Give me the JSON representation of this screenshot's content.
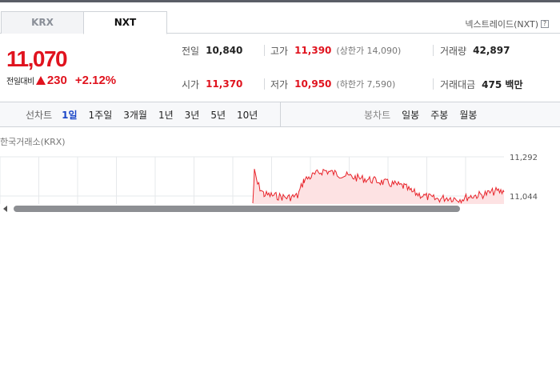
{
  "tabs": [
    {
      "label": "KRX",
      "active": false
    },
    {
      "label": "NXT",
      "active": true
    }
  ],
  "nxt_link": {
    "label": "넥스트레이드(NXT)",
    "icon": "help-icon",
    "icon_glyph": "?"
  },
  "quote": {
    "price": "11,070",
    "change_label": "전일대비",
    "change_value": "230",
    "change_pct": "+2.12%",
    "direction": "up",
    "color": "#e0131e"
  },
  "stats": {
    "prev_close": {
      "label": "전일",
      "value": "10,840"
    },
    "high": {
      "label": "고가",
      "value": "11,390",
      "sub": "(상한가 14,090)"
    },
    "volume": {
      "label": "거래량",
      "value": "42,897"
    },
    "open": {
      "label": "시가",
      "value": "11,370"
    },
    "low": {
      "label": "저가",
      "value": "10,950",
      "sub": "(하한가 7,590)"
    },
    "amount": {
      "label": "거래대금",
      "value": "475 백만"
    }
  },
  "periods": {
    "title": "선차트",
    "items": [
      "1일",
      "1주일",
      "3개월",
      "1년",
      "3년",
      "5년",
      "10년"
    ],
    "active_index": 0
  },
  "candles": {
    "title": "봉차트",
    "items": [
      "일봉",
      "주봉",
      "월봉"
    ]
  },
  "chart": {
    "label": "한국거래소(KRX)",
    "y_ticks": [
      "11,292",
      "11,044"
    ],
    "ylim": [
      11044,
      11292
    ],
    "line_color": "#e8232a",
    "fill_color": "#fde2e3"
  }
}
